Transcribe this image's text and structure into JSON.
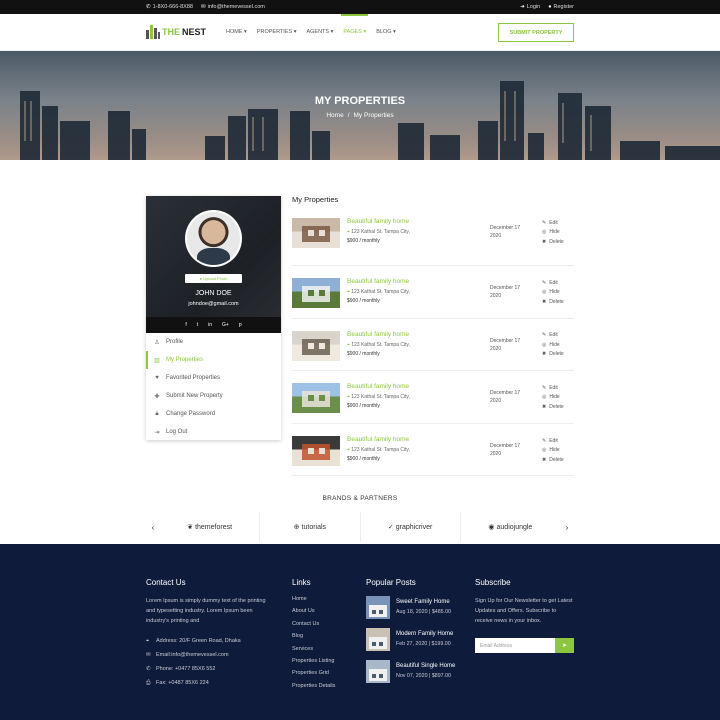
{
  "topbar": {
    "phone": "1-8X0-666-8X88",
    "email": "info@themevessel.com",
    "login": "Login",
    "register": "Register"
  },
  "brand": {
    "name_the": "THE",
    "name_nest": "NEST",
    "accent": "#8cc63f"
  },
  "nav": {
    "items": [
      {
        "label": "HOME"
      },
      {
        "label": "PROPERTIES"
      },
      {
        "label": "AGENTS"
      },
      {
        "label": "PAGES"
      },
      {
        "label": "BLOG"
      }
    ],
    "submit": "SUBMIT PROPERTY"
  },
  "hero": {
    "title": "MY PROPERTIES",
    "crumb_home": "Home",
    "crumb_sep": "/",
    "crumb_current": "My Properties"
  },
  "profile": {
    "upload": "Upload Photo",
    "name": "JOHN DOE",
    "email": "johndoe@gmail.com",
    "social": [
      "f",
      "t",
      "in",
      "G+",
      "p"
    ]
  },
  "sidemenu": [
    {
      "label": "Profile",
      "icon": "user-icon"
    },
    {
      "label": "My Properties",
      "icon": "building-icon"
    },
    {
      "label": "Favorited Properties",
      "icon": "heart-icon"
    },
    {
      "label": "Submit New Property",
      "icon": "plus-icon"
    },
    {
      "label": "Change Password",
      "icon": "lock-icon"
    },
    {
      "label": "Log Out",
      "icon": "logout-icon"
    }
  ],
  "list": {
    "heading": "My Properties",
    "items": [
      {
        "title": "Beautiful family home",
        "address": "123 Kathal St. Tampa City,",
        "price": "$900 / monthly",
        "date": "December 17 2020"
      },
      {
        "title": "Beautiful family home",
        "address": "123 Kathal St. Tampa City,",
        "price": "$900 / monthly",
        "date": "December 17 2020"
      },
      {
        "title": "Beautiful family home",
        "address": "123 Kathal St. Tampa City,",
        "price": "$900 / monthly",
        "date": "December 17 2020"
      },
      {
        "title": "Beautiful family home",
        "address": "123 Kathal St. Tampa City,",
        "price": "$900 / monthly",
        "date": "December 17 2020"
      },
      {
        "title": "Beautiful family home",
        "address": "123 Kathal St. Tampa City,",
        "price": "$900 / monthly",
        "date": "December 17 2020"
      }
    ],
    "actions": {
      "edit": "Edit",
      "hide": "Hide",
      "delete": "Delete"
    }
  },
  "brands": {
    "title": "BRANDS & PARTNERS",
    "items": [
      "themeforest",
      "tutorials",
      "graphicriver",
      "audiojungle"
    ],
    "prev": "‹",
    "next": "›"
  },
  "footer": {
    "contact": {
      "title": "Contact Us",
      "text": "Lorem Ipsum is simply dummy text of the printing and typesetting industry. Lorem Ipsum been industry's printing and",
      "address": "Address: 20/F Green Road, Dhaka",
      "email": "Email:info@themevessel.com",
      "phone": "Phone: +0477 85X6 552",
      "fax": "Fax: +0487 85X6 224"
    },
    "links": {
      "title": "Links",
      "items": [
        "Home",
        "About Us",
        "Contact Us",
        "Blog",
        "Services",
        "Properties Listing",
        "Properties Grid",
        "Properties Details"
      ]
    },
    "posts": {
      "title": "Popular Posts",
      "items": [
        {
          "name": "Sweet Family Home",
          "meta": "Aug 18, 2020 | $485.00"
        },
        {
          "name": "Modern Family Home",
          "meta": "Feb 27, 2020 | $199.00"
        },
        {
          "name": "Beautiful Single Home",
          "meta": "Nov 07, 2020 | $897.00"
        }
      ]
    },
    "subscribe": {
      "title": "Subscribe",
      "text": "Sign Up for Our Newsletter to get Latest Updates and Offers. Subscribe to receive news in your inbox.",
      "placeholder": "Email Address"
    }
  }
}
